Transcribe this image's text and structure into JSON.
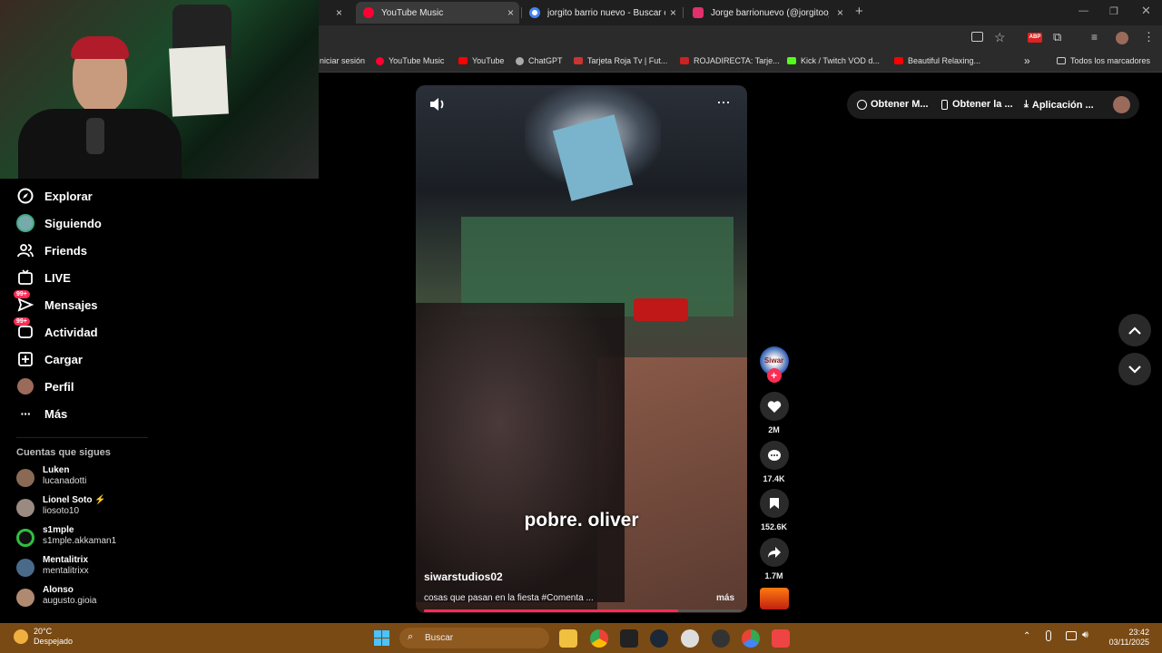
{
  "browser": {
    "tabs": [
      {
        "label": "YouTube Music",
        "color": "#ff0033"
      },
      {
        "label": "jorgito barrio nuevo - Buscar co",
        "color": "#4285f4"
      },
      {
        "label": "Jorge barrionuevo (@jorgitoo_",
        "color": "#e1306c"
      }
    ],
    "new_tab": "+",
    "bookmarks": [
      {
        "label": "niciar sesión",
        "color": ""
      },
      {
        "label": "YouTube Music",
        "color": "#ff0033"
      },
      {
        "label": "YouTube",
        "color": "#ff0000"
      },
      {
        "label": "ChatGPT",
        "color": "#aaaaaa"
      },
      {
        "label": "Tarjeta Roja Tv | Fut...",
        "color": "#cc3333"
      },
      {
        "label": "ROJADIRECTA: Tarje...",
        "color": "#cc2222"
      },
      {
        "label": "Kick / Twitch VOD d...",
        "color": "#53fc18"
      },
      {
        "label": "Beautiful Relaxing...",
        "color": "#ff0000"
      }
    ],
    "bookmarks_more": "»",
    "all_bookmarks": "Todos los marcadores"
  },
  "sidebar": {
    "items": [
      {
        "label": "Explorar",
        "icon": "compass-icon",
        "badge": ""
      },
      {
        "label": "Siguiendo",
        "icon": "following-avatar-icon",
        "badge": ""
      },
      {
        "label": "Friends",
        "icon": "friends-icon",
        "badge": ""
      },
      {
        "label": "LIVE",
        "icon": "live-tv-icon",
        "badge": ""
      },
      {
        "label": "Mensajes",
        "icon": "message-icon",
        "badge": "99+"
      },
      {
        "label": "Actividad",
        "icon": "activity-icon",
        "badge": "99+"
      },
      {
        "label": "Cargar",
        "icon": "upload-icon",
        "badge": ""
      },
      {
        "label": "Perfil",
        "icon": "profile-avatar-icon",
        "badge": ""
      },
      {
        "label": "Más",
        "icon": "more-dots-icon",
        "badge": ""
      }
    ],
    "following_title": "Cuentas que sigues",
    "accounts": [
      {
        "name": "Luken",
        "user": "lucanadotti",
        "color": "#8a6a55"
      },
      {
        "name": "Lionel Soto",
        "user": "liosoto10",
        "color": "#9a8a80"
      },
      {
        "name": "s1mple",
        "user": "s1mple.akkaman1",
        "color": "#2fbf3f"
      },
      {
        "name": "Mentalitrix",
        "user": "mentalitrixx",
        "color": "#4a6a8a"
      },
      {
        "name": "Alonso",
        "user": "augusto.gioia",
        "color": "#b08a70"
      }
    ]
  },
  "video": {
    "caption": "pobre. oliver",
    "author": "siwarstudios02",
    "description": "cosas que pasan en la fiesta #Comenta ...",
    "more": "más",
    "progress": 0.8
  },
  "actions": [
    {
      "icon": "heart-icon",
      "count": "2M"
    },
    {
      "icon": "comment-icon",
      "count": "17.4K"
    },
    {
      "icon": "bookmark-icon",
      "count": "152.6K"
    },
    {
      "icon": "share-icon",
      "count": "1.7M"
    }
  ],
  "top_actions": [
    {
      "label": "Obtener M...",
      "icon": "coin-icon"
    },
    {
      "label": "Obtener la ...",
      "icon": "phone-icon"
    },
    {
      "label": "Aplicación ...",
      "icon": "download-icon"
    }
  ],
  "taskbar": {
    "weather_temp": "20°C",
    "weather_desc": "Despejado",
    "search_placeholder": "Buscar",
    "time": "23:42",
    "date": "03/11/2025"
  }
}
